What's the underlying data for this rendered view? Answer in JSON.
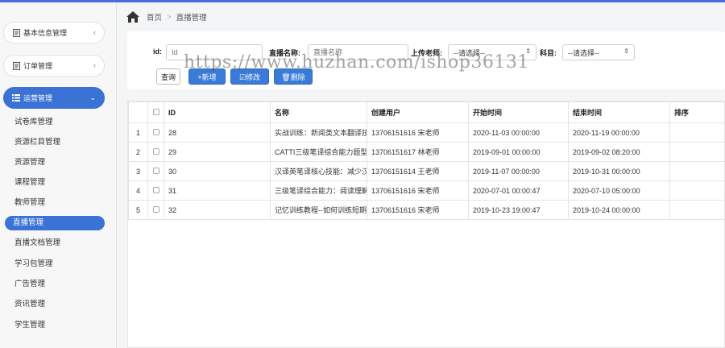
{
  "sidebar": {
    "groups": [
      {
        "label": "基本信息管理",
        "icon": "document-icon",
        "chevron": "‹"
      },
      {
        "label": "订单管理",
        "icon": "document-icon",
        "chevron": "‹"
      },
      {
        "label": "运营管理",
        "icon": "list-icon",
        "chevron": "⌄"
      }
    ],
    "items": [
      "试卷库管理",
      "资源栏目管理",
      "资源管理",
      "课程管理",
      "教师管理",
      "直播管理",
      "直播文档管理",
      "学习包管理",
      "广告管理",
      "资讯管理",
      "学生管理"
    ],
    "active_item": "直播管理"
  },
  "breadcrumb": {
    "home": "首页",
    "separator": ">",
    "current": "直播管理"
  },
  "filters": {
    "id_label": "id:",
    "id_placeholder": "Id",
    "name_label": "直播名称:",
    "name_placeholder": "直播名称",
    "teacher_label": "上传老师:",
    "teacher_value": "--请选择--",
    "subject_label": "科目:",
    "subject_value": "--请选择--"
  },
  "buttons": {
    "query": "查询",
    "add": "+新增",
    "edit": "☑修改",
    "delete": "🗑删除"
  },
  "watermark": "https://www.huzhan.com/ishop36131",
  "table": {
    "headers": [
      "",
      "",
      "ID",
      "名称",
      "创建用户",
      "开始时间",
      "结束时间",
      "排序"
    ],
    "rows": [
      {
        "no": "1",
        "id": "28",
        "name": "实战训练：新闻类文本翻译技",
        "user": "13706151616 宋老师",
        "start": "2020-11-03 00:00:00",
        "end": "2020-11-19 00:00:00",
        "sort": ""
      },
      {
        "no": "2",
        "id": "29",
        "name": "CATTI三级笔译综合能力题型",
        "user": "13706151617 林老师",
        "start": "2019-09-01 00:00:00",
        "end": "2019-09-02 08:20:00",
        "sort": ""
      },
      {
        "no": "3",
        "id": "30",
        "name": "汉译英笔译核心技能：减少汉",
        "user": "13706151614 王老师",
        "start": "2019-11-07 00:00:00",
        "end": "2019-10-31 00:00:00",
        "sort": ""
      },
      {
        "no": "4",
        "id": "31",
        "name": "三级笔译综合能力：阅读理解",
        "user": "13706151616 宋老师",
        "start": "2020-07-01 00:00:47",
        "end": "2020-07-10 05:00:00",
        "sort": ""
      },
      {
        "no": "5",
        "id": "32",
        "name": "记忆训练教程--如何训练短期",
        "user": "13706151616 宋老师",
        "start": "2019-10-23 19:00:47",
        "end": "2019-10-24 00:00:00",
        "sort": ""
      }
    ]
  },
  "colors": {
    "accent": "#3a72d6",
    "primary_button": "#3b7bd8"
  }
}
